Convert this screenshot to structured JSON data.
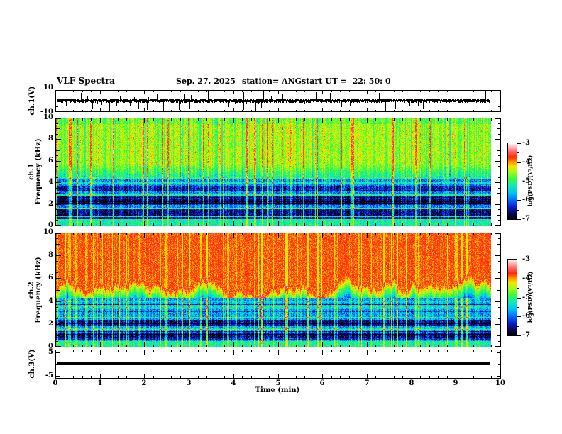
{
  "header": {
    "title": "VLF Spectra",
    "date": "Sep. 27, 2025",
    "station": "station= ANG",
    "start_ut": "start UT =  22: 50: 0"
  },
  "axes": {
    "time": {
      "label": "Time (min)",
      "min": 0,
      "max": 10,
      "tick_labels": [
        "0",
        "1",
        "2",
        "3",
        "4",
        "5",
        "6",
        "7",
        "8",
        "9",
        "10"
      ],
      "minor_step": 0.2,
      "data_end_min": 9.8
    },
    "freq": {
      "label": "Frequency (kHz)",
      "min": 0,
      "max": 10,
      "tick_labels": [
        "10",
        "8",
        "6",
        "4",
        "2",
        "0"
      ],
      "tick_values": [
        10,
        8,
        6,
        4,
        2,
        0
      ],
      "minor_step": 0.5
    },
    "ch1": {
      "name": "ch.1",
      "waveform_label": "ch.1(V)",
      "volt_tick_labels": [
        "10",
        "-10"
      ],
      "volt_tick_values": [
        10,
        -10
      ],
      "vmin": -10,
      "vmax": 10
    },
    "ch2": {
      "name": "ch.2"
    },
    "ch3": {
      "waveform_label": "ch.3(V)",
      "volt_tick_labels": [
        "5",
        "-5"
      ],
      "volt_tick_values": [
        5,
        -5
      ],
      "vmin": -5,
      "vmax": 5
    }
  },
  "colorbar": {
    "label": "log(PSD)(V²/Hz)",
    "tick_labels": [
      "-3",
      "-4",
      "-5",
      "-6",
      "-7"
    ],
    "tick_values": [
      -3,
      -4,
      -5,
      -6,
      -7
    ],
    "zmin": -7,
    "zmax": -3,
    "stops": [
      [
        -7.0,
        [
          0,
          0,
          0
        ]
      ],
      [
        -6.7,
        [
          8,
          8,
          95
        ]
      ],
      [
        -6.35,
        [
          15,
          30,
          210
        ]
      ],
      [
        -6.0,
        [
          0,
          110,
          255
        ]
      ],
      [
        -5.6,
        [
          0,
          200,
          240
        ]
      ],
      [
        -5.2,
        [
          20,
          235,
          170
        ]
      ],
      [
        -4.85,
        [
          60,
          250,
          60
        ]
      ],
      [
        -4.5,
        [
          170,
          250,
          20
        ]
      ],
      [
        -4.2,
        [
          250,
          225,
          0
        ]
      ],
      [
        -3.95,
        [
          255,
          140,
          0
        ]
      ],
      [
        -3.72,
        [
          255,
          40,
          5
        ]
      ],
      [
        -3.45,
        [
          255,
          100,
          100
        ]
      ],
      [
        -3.2,
        [
          255,
          175,
          175
        ]
      ],
      [
        -3.0,
        [
          255,
          248,
          248
        ]
      ]
    ]
  },
  "chart_data": [
    {
      "type": "line",
      "name": "ch1_time_series",
      "ylabel": "ch.1(V)",
      "ylim": [
        -10,
        10
      ],
      "xlim_min": [
        0,
        10
      ],
      "character": "continuous broadband noise of about ±2 V with random impulsive spikes (sferics) reaching ±9 V across the whole 0–9.8 min record",
      "noise_amp_v": 2,
      "spike_prob": 0.05,
      "spike_max_v": 9,
      "seed": 11
    },
    {
      "type": "heatmap",
      "name": "ch1_spectrogram",
      "kind": "ch1",
      "flim": [
        0,
        10
      ],
      "tlim_min": [
        0,
        9.8
      ],
      "zlim": [
        -7,
        -3
      ],
      "zunits": "log(PSD)(V²/Hz)",
      "character": "above ~4.6 kHz yellow-green continuum near -4.5 with dense red vertical sferic streaks; 0.6–4.6 kHz blue background near -6 with dark horizontal bands and bright vertical streaks; green band below 0.55 kHz",
      "seed": 7,
      "zones": {
        "upper": {
          "fmin": 4.6,
          "base": -4.55,
          "noise": 0.5,
          "streak_gain": 1.15,
          "fade_below": 5.8,
          "fade_rate": 0.5
        },
        "lower": {
          "fmin": 0.55,
          "base": -6.05,
          "noise": 0.6,
          "streak_gain": 1.7
        },
        "bottom": {
          "base": -5.3,
          "noise": 0.5,
          "streak_gain": 0.9
        }
      },
      "bands": [
        [
          0.58,
          0.72,
          -0.7
        ],
        [
          0.85,
          1.45,
          -0.75
        ],
        [
          1.9,
          2.6,
          -0.85
        ],
        [
          3.3,
          3.75,
          -0.55
        ],
        [
          1.5,
          1.62,
          0.75
        ],
        [
          2.72,
          2.88,
          0.65
        ],
        [
          3.9,
          4.02,
          0.55
        ],
        [
          4.32,
          4.55,
          0.8
        ]
      ],
      "streaks": {
        "prob": 0.1,
        "min": 0.55,
        "max": 1.05
      },
      "dark_streaks": {
        "prob": 0.05,
        "min": 0.3,
        "max": 0.8
      }
    },
    {
      "type": "heatmap",
      "name": "ch2_spectrogram",
      "kind": "ch2",
      "flim": [
        0,
        10
      ],
      "tlim_min": [
        0,
        9.8
      ],
      "zlim": [
        -7,
        -3
      ],
      "zunits": "log(PSD)(V²/Hz)",
      "character": "red continuum near -3.8 above a wavy 4.5–6.3 kHz boundary with yellow fingers descending; cyan/blue background below with black bands near 1 and 2 kHz; green band below 0.5 kHz",
      "seed": 13,
      "edge": {
        "base": 5.4,
        "var": 1.0,
        "gain": 1.2,
        "top_base": -3.75,
        "top_noise": 0.35,
        "top_streak_gain": -0.55,
        "mid_streak_gain": 0.5
      },
      "zones": {
        "lower": {
          "fmin": 0.5,
          "fmax": 4.3,
          "base": -5.95,
          "noise": 0.6,
          "streak_gain": 1.7
        },
        "bottom": {
          "base": -5.25,
          "noise": 0.5,
          "streak_gain": 0.9
        }
      },
      "bands": [
        [
          0.58,
          0.7,
          -0.6
        ],
        [
          0.75,
          1.35,
          -0.85
        ],
        [
          0.95,
          1.08,
          -0.6
        ],
        [
          1.85,
          2.35,
          -0.8
        ],
        [
          2.0,
          2.12,
          -0.55
        ],
        [
          1.48,
          1.6,
          0.8
        ],
        [
          2.5,
          2.64,
          0.6
        ],
        [
          3.45,
          3.58,
          0.45
        ]
      ],
      "streaks": {
        "prob": 0.12,
        "min": 0.55,
        "max": 1.1
      }
    },
    {
      "type": "line",
      "name": "ch3_time_series",
      "ylabel": "ch.3(V)",
      "ylim": [
        -5,
        5
      ],
      "constant_value_v": 0,
      "character": "flat heavy black line at 0 V for the full record",
      "seed": 3
    }
  ]
}
